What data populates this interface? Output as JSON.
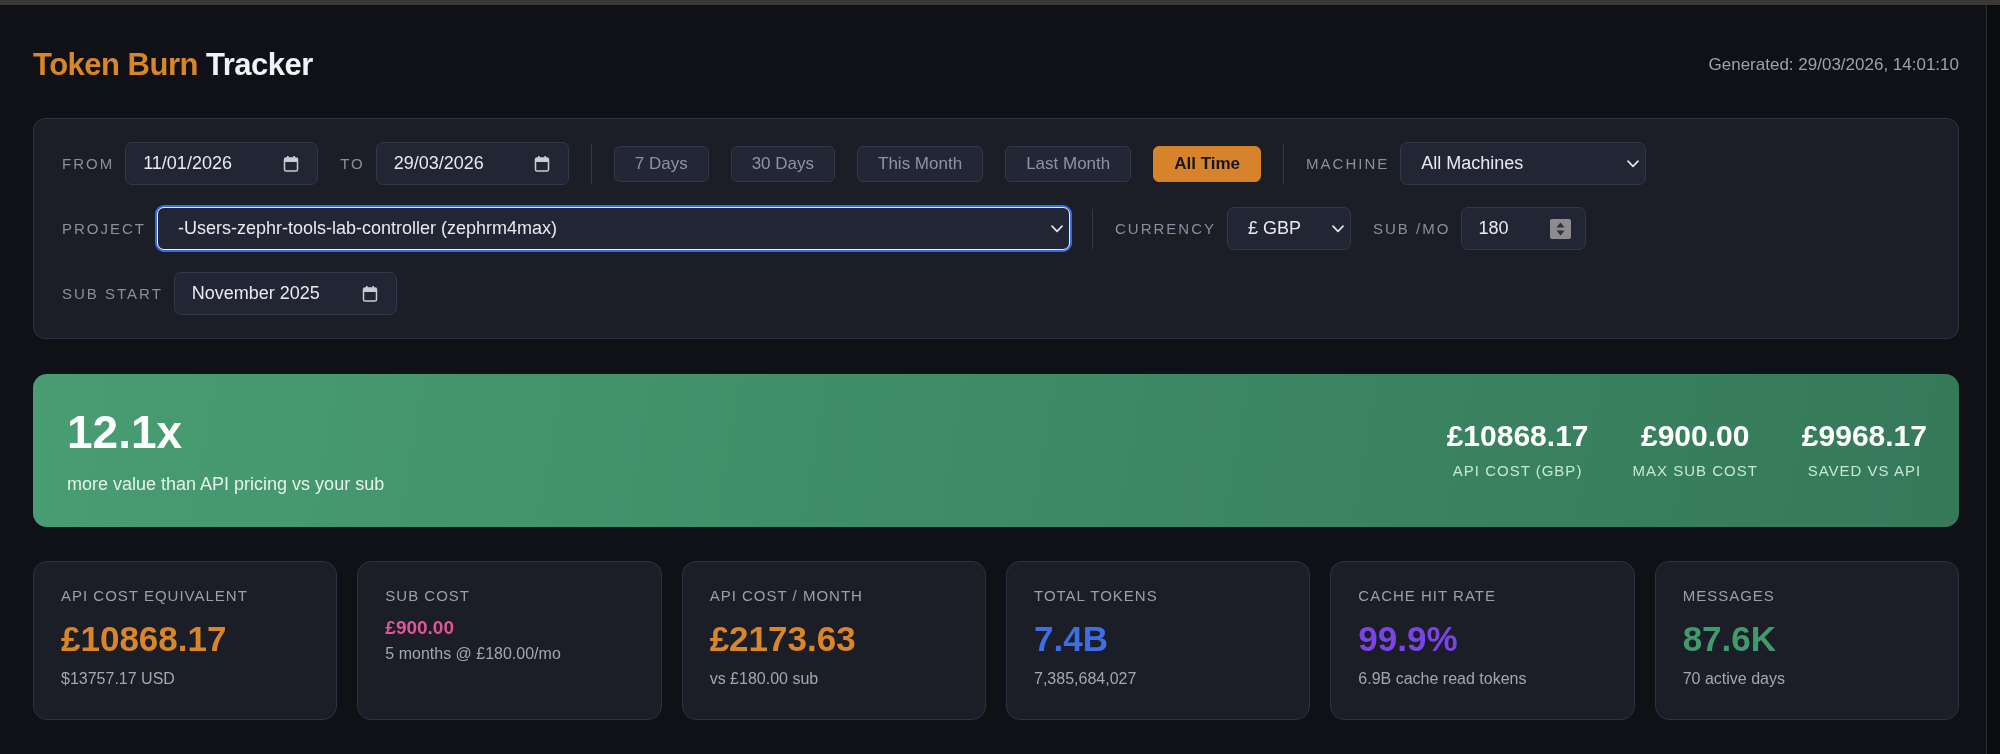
{
  "header": {
    "title_accent": "Token Burn",
    "title_main": "Tracker",
    "generated": "Generated: 29/03/2026, 14:01:10"
  },
  "filters": {
    "rows": [
      {
        "groups": [
          {
            "controls": [
              {
                "kind": "date",
                "label": "FROM",
                "value": "11/01/2026",
                "focused": false
              },
              {
                "kind": "date",
                "label": "TO",
                "value": "29/03/2026",
                "focused": false
              }
            ]
          },
          {
            "controls": [
              {
                "kind": "presets",
                "options": [
                  {
                    "label": "7 Days",
                    "selected": false
                  },
                  {
                    "label": "30 Days",
                    "selected": false
                  },
                  {
                    "label": "This Month",
                    "selected": false
                  },
                  {
                    "label": "Last Month",
                    "selected": false
                  },
                  {
                    "label": "All Time",
                    "selected": true
                  }
                ]
              }
            ]
          },
          {
            "controls": [
              {
                "kind": "select",
                "label": "MACHINE",
                "value": "All Machines",
                "focused": false
              }
            ]
          }
        ]
      },
      {
        "groups": [
          {
            "controls": [
              {
                "kind": "select",
                "label": "PROJECT",
                "value": "-Users-zephr-tools-lab-controller (zephrm4max)",
                "focused": true
              }
            ]
          },
          {
            "controls": [
              {
                "kind": "select",
                "label": "CURRENCY",
                "value": "£ GBP",
                "focused": false
              },
              {
                "kind": "number",
                "label": "SUB /MO",
                "value": "180",
                "focused": false
              }
            ]
          }
        ]
      },
      {
        "groups": [
          {
            "controls": [
              {
                "kind": "month",
                "label": "SUB START",
                "value": "November 2025",
                "focused": false
              }
            ]
          }
        ]
      }
    ]
  },
  "banner": {
    "ratio": "12.1x",
    "caption": "more value than API pricing vs your sub",
    "stats": [
      {
        "value": "£10868.17",
        "label": "API COST (GBP)"
      },
      {
        "value": "£900.00",
        "label": "MAX SUB COST"
      },
      {
        "value": "£9968.17",
        "label": "SAVED VS API"
      }
    ]
  },
  "stat_cards": [
    {
      "kind": "headline",
      "label": "API COST EQUIVALENT",
      "value": "£10868.17",
      "detail": "$13757.17 USD",
      "color": "#d9862b"
    },
    {
      "kind": "compact",
      "label": "SUB COST",
      "value": "£900.00",
      "detail": "5 months @ £180.00/mo",
      "color": "#e0559b"
    },
    {
      "kind": "headline",
      "label": "API COST / MONTH",
      "value": "£2173.63",
      "detail": "vs £180.00 sub",
      "color": "#d9862b"
    },
    {
      "kind": "headline",
      "label": "TOTAL TOKENS",
      "value": "7.4B",
      "detail": "7,385,684,027",
      "color": "#3e6ee3"
    },
    {
      "kind": "headline",
      "label": "CACHE HIT RATE",
      "value": "99.9%",
      "detail": "6.9B cache read tokens",
      "color": "#7a44e6"
    },
    {
      "kind": "headline",
      "label": "MESSAGES",
      "value": "87.6K",
      "detail": "70 active days",
      "color": "#419a6b"
    }
  ]
}
